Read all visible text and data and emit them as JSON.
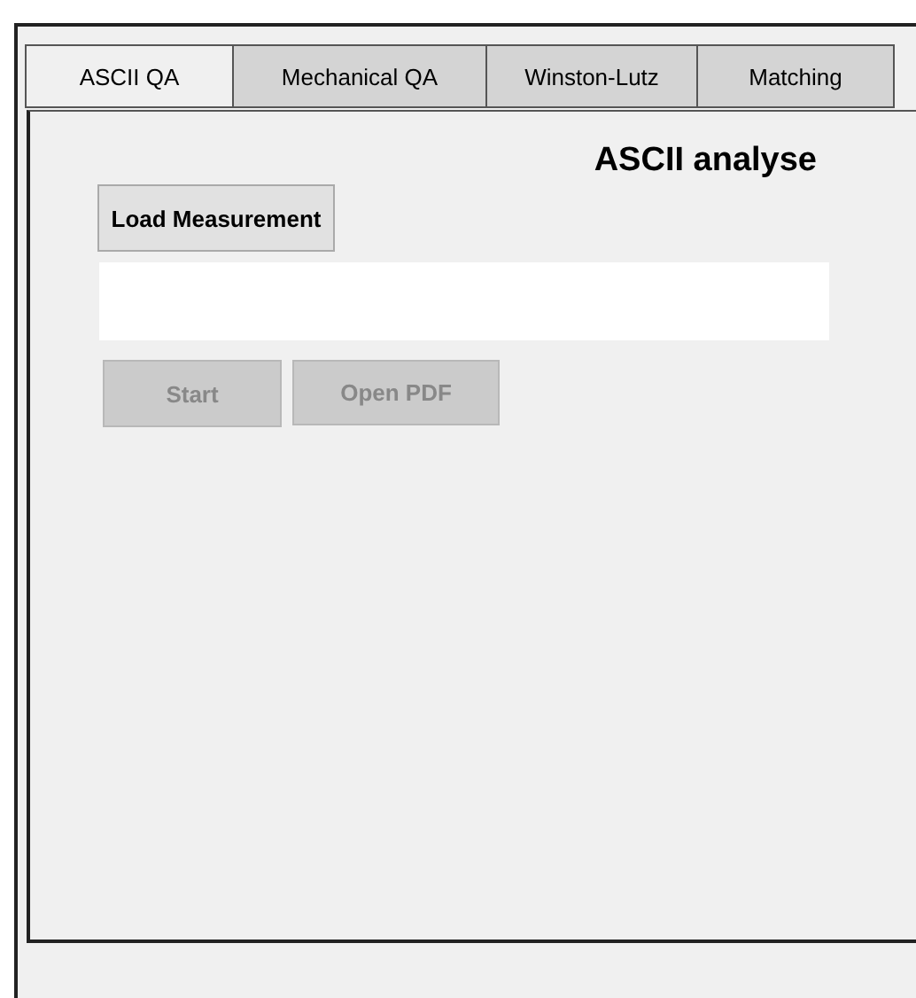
{
  "tabs": [
    {
      "label": "ASCII QA",
      "selected": true
    },
    {
      "label": "Mechanical QA",
      "selected": false
    },
    {
      "label": "Winston-Lutz",
      "selected": false
    },
    {
      "label": "Matching",
      "selected": false
    }
  ],
  "panel": {
    "title": "ASCII analyse",
    "load_button": {
      "label": "Load Measurement",
      "disabled": false
    },
    "action_buttons": [
      {
        "label": "Start",
        "disabled": true
      },
      {
        "label": "Open PDF",
        "disabled": true
      }
    ]
  }
}
